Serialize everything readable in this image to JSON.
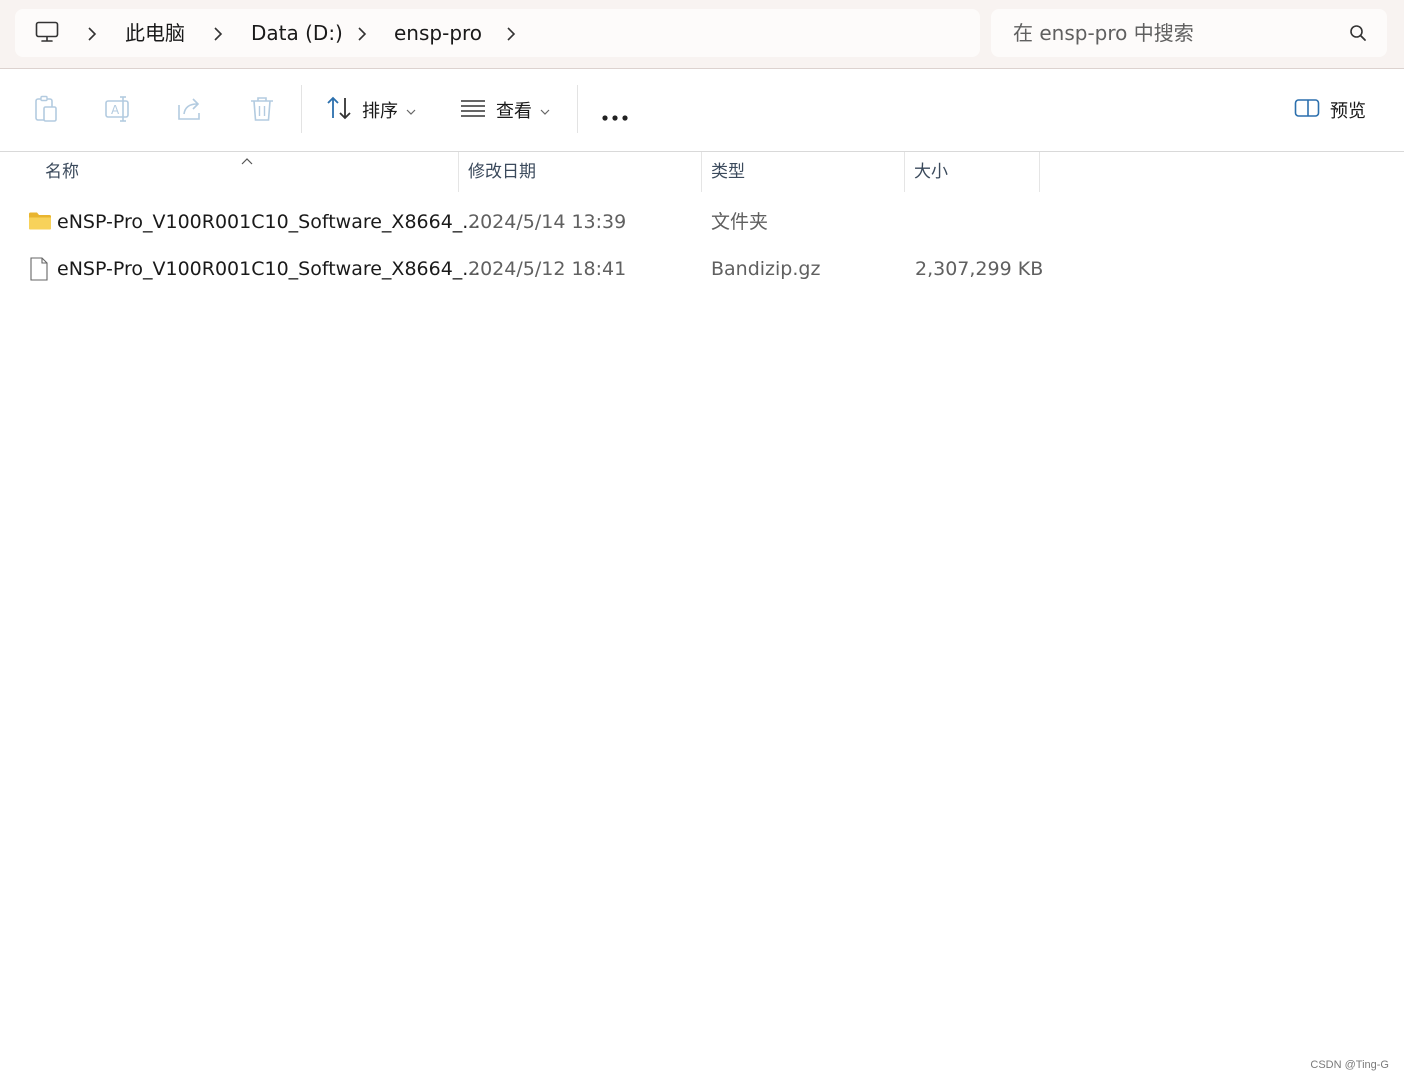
{
  "address_bar": {
    "icon": "computer-icon",
    "breadcrumbs": [
      "此电脑",
      "Data (D:)",
      "ensp-pro"
    ]
  },
  "search": {
    "placeholder": "在 ensp-pro 中搜索",
    "icon": "search-icon"
  },
  "toolbar": {
    "disabled_icons": [
      "paste-icon",
      "rename-icon",
      "share-icon",
      "delete-icon"
    ],
    "sort_label": "排序",
    "view_label": "查看",
    "more_icon": "more-icon",
    "preview_label": "预览"
  },
  "columns": {
    "name": "名称",
    "date": "修改日期",
    "type": "类型",
    "size": "大小"
  },
  "files": [
    {
      "icon": "folder-icon",
      "name": "eNSP-Pro_V100R001C10_Software_X8664_...",
      "date": "2024/5/14 13:39",
      "type": "文件夹",
      "size": ""
    },
    {
      "icon": "file-icon",
      "name": "eNSP-Pro_V100R001C10_Software_X8664_...",
      "date": "2024/5/12 18:41",
      "type": "Bandizip.gz",
      "size": "2,307,299 KB"
    }
  ],
  "watermark": "CSDN @Ting-G",
  "colors": {
    "title_bar_bg": "#f8f3f1",
    "disabled_icon": "#b3cbe0",
    "accent_blue": "#2b6fad",
    "folder_yellow": "#f5c742"
  }
}
